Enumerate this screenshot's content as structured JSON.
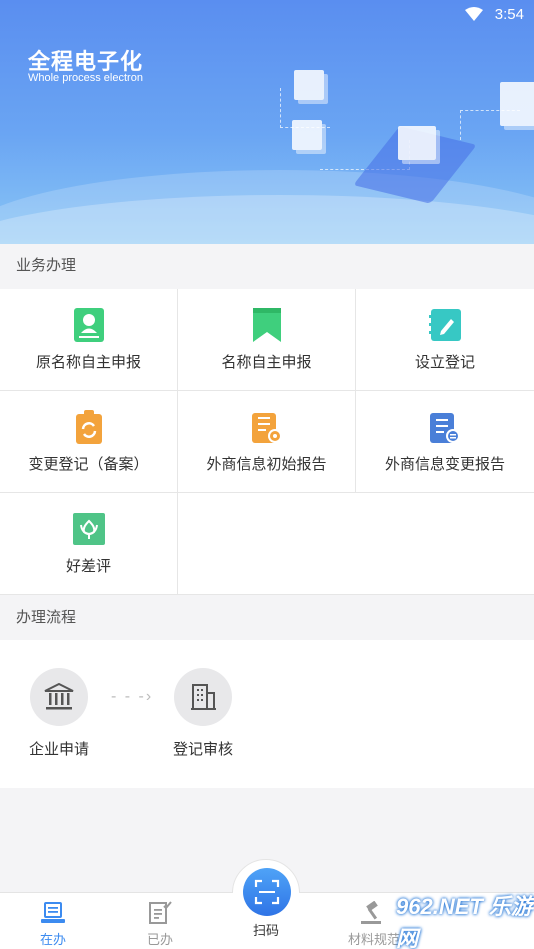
{
  "status_bar": {
    "time": "3:54"
  },
  "banner": {
    "title": "全程电子化",
    "subtitle": "Whole process electron"
  },
  "services": {
    "section_title": "业务办理",
    "items": [
      {
        "label": "原名称自主申报",
        "icon": "id-card-icon",
        "color": "#3fcf7d"
      },
      {
        "label": "名称自主申报",
        "icon": "bookmark-icon",
        "color": "#3fcf7d"
      },
      {
        "label": "设立登记",
        "icon": "notebook-edit-icon",
        "color": "#37c8c4"
      },
      {
        "label": "变更登记（备案）",
        "icon": "clipboard-refresh-icon",
        "color": "#f3a33c"
      },
      {
        "label": "外商信息初始报告",
        "icon": "clipboard-report-icon",
        "color": "#f3a33c"
      },
      {
        "label": "外商信息变更报告",
        "icon": "clipboard-exchange-icon",
        "color": "#4a7fd8"
      },
      {
        "label": "好差评",
        "icon": "flower-rating-icon",
        "color": "#4fc487"
      }
    ]
  },
  "process": {
    "section_title": "办理流程",
    "steps": [
      {
        "label": "企业申请",
        "icon": "bank-building-icon"
      },
      {
        "label": "登记审核",
        "icon": "office-building-icon"
      }
    ]
  },
  "tabbar": {
    "tabs": [
      {
        "label": "在办",
        "icon": "document-stack-icon",
        "active": true
      },
      {
        "label": "已办",
        "icon": "document-check-icon",
        "active": false
      },
      {
        "label": "扫码",
        "icon": "scan-icon",
        "active": false
      },
      {
        "label": "材料规范",
        "icon": "gavel-icon",
        "active": false
      }
    ]
  },
  "watermark": "962.NET 乐游网",
  "colors": {
    "accent": "#3c8bf0",
    "banner_top": "#5a8ef0",
    "banner_bottom": "#8ac6f5"
  }
}
